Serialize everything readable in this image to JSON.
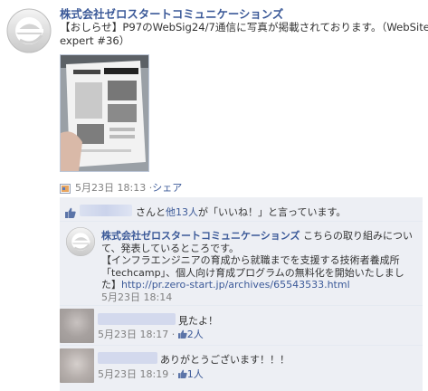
{
  "post": {
    "author": "株式会社ゼロスタートコミュニケーションズ",
    "text_line1": "【おしらせ】P97のWebSig24/7通信に写真が掲載されております。（WebSite",
    "text_line2": "expert #36）",
    "date": "5月23日 18:13",
    "dot": "·",
    "share_label": "シェア"
  },
  "likes": {
    "text_pre": "さんと",
    "others": "他13人",
    "text_post": "が「いいね！」と言っています。"
  },
  "comments": [
    {
      "author": "株式会社ゼロスタートコミュニケーションズ",
      "text_line1_suffix": " こちらの取り組みについ",
      "text_line2": "て、発表しているところです。",
      "text_line3": "【インフラエンジニアの育成から就職までを支援する技術者養成所",
      "text_line4": "「techcamp」、個人向け育成プログラムの無料化を開始いたしまし",
      "text_line5_prefix": "た】",
      "link": "http://pr.zero-start.jp/archives/65543533.html",
      "date": "5月23日 18:14"
    },
    {
      "text": "見たよ！",
      "date": "5月23日 18:17",
      "dot": "·",
      "like_count": "2人"
    },
    {
      "text": "ありがとうございます！！！",
      "date": "5月23日 18:19",
      "dot": "·",
      "like_count": "1人"
    }
  ],
  "colors": {
    "link": "#3b5998",
    "muted": "#808080",
    "ufi_background": "#edeff4"
  }
}
